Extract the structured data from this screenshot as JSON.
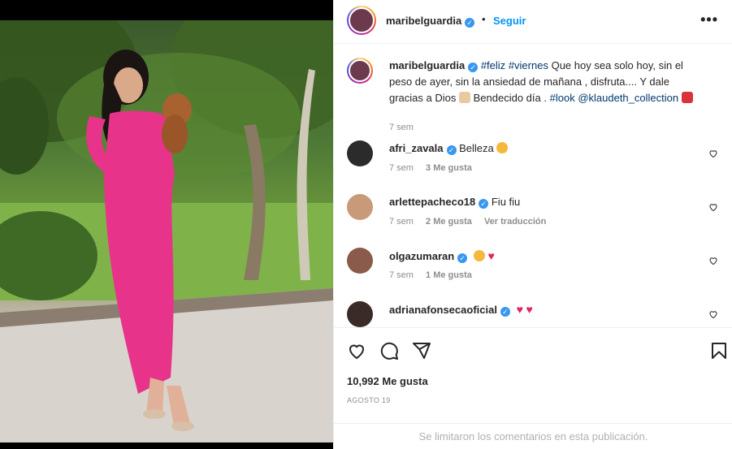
{
  "post": {
    "author": "maribelguardia",
    "follow_label": "Seguir",
    "follow_separator": "•",
    "more_label": "•••",
    "caption": {
      "author": "maribelguardia",
      "hashtag1": "#feliz",
      "hashtag2": "#viernes",
      "text1": "Que hoy sea solo hoy, sin el peso de ayer, sin la ansiedad de mañana , disfruta.... Y dale gracias a Dios",
      "text2": "Bendecido día .",
      "hashtag3": "#look",
      "mention": "@klaudeth_collection",
      "time": "7 sem"
    },
    "likes": "10,992 Me gusta",
    "date": "AGOSTO 19",
    "comments_limited": "Se limitaron los comentarios en esta publicación."
  },
  "comments": [
    {
      "user": "afri_zavala",
      "text": "Belleza",
      "time": "7 sem",
      "likes": "3 Me gusta",
      "translate": ""
    },
    {
      "user": "arlettepacheco18",
      "text": "Fiu fiu",
      "time": "7 sem",
      "likes": "2 Me gusta",
      "translate": "Ver traducción"
    },
    {
      "user": "olgazumaran",
      "text": "",
      "time": "7 sem",
      "likes": "1 Me gusta",
      "translate": ""
    },
    {
      "user": "adrianafonsecaoficial",
      "text": "",
      "time": "",
      "likes": "",
      "translate": ""
    }
  ],
  "icons": [
    "heart-icon",
    "comment-icon",
    "share-icon",
    "save-icon",
    "verified-icon",
    "more-icon"
  ],
  "colors": {
    "link": "#0095f6",
    "hashtag": "#00376b",
    "verified": "#3897f0",
    "dress": "#e8338a"
  }
}
